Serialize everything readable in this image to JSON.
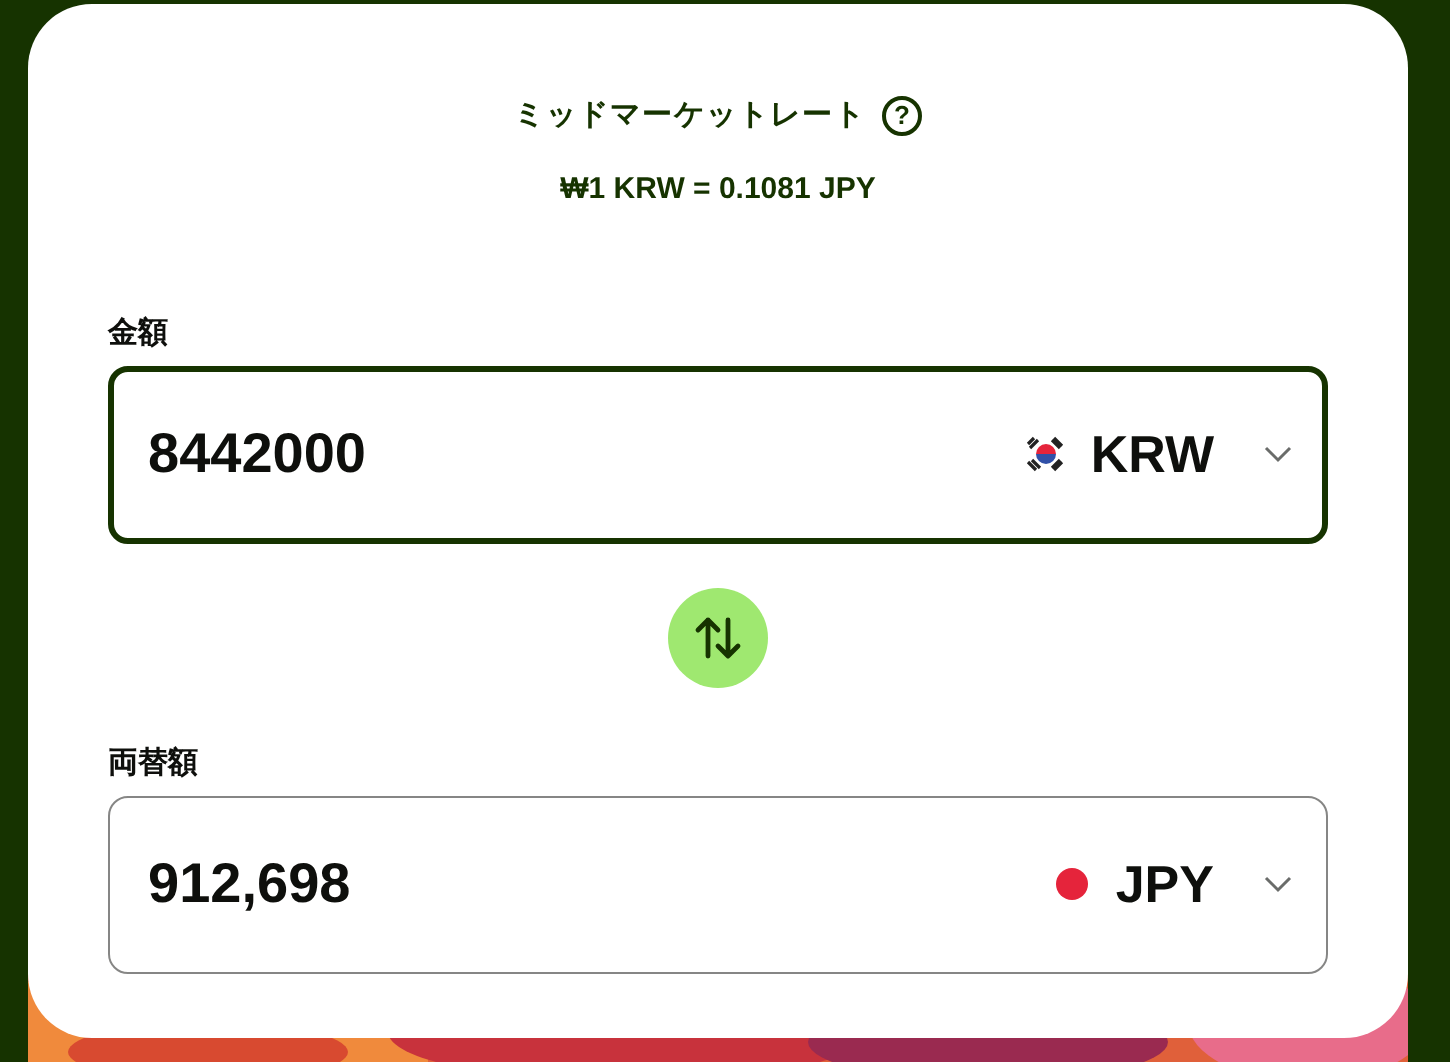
{
  "rate": {
    "title": "ミッドマーケットレート",
    "help_icon": "?",
    "value": "₩1 KRW = 0.1081 JPY"
  },
  "fields": [
    {
      "label": "金額",
      "value": "8442000",
      "currency": "KRW",
      "focused": true
    },
    {
      "label": "両替額",
      "value": "912,698",
      "currency": "JPY",
      "focused": false
    }
  ]
}
